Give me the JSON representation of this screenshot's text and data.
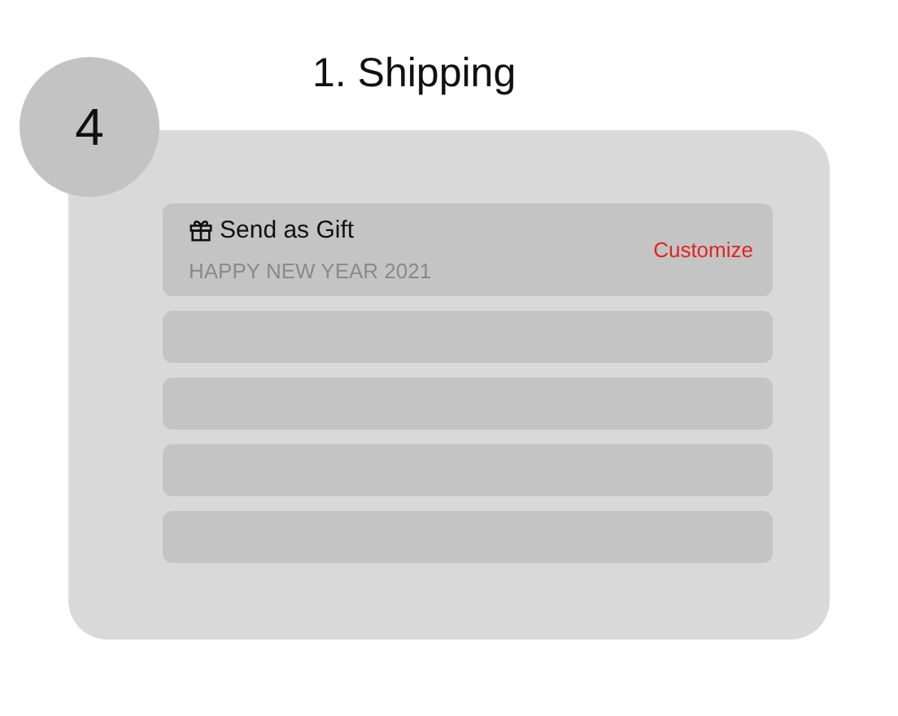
{
  "title": "1. Shipping",
  "step_badge": "4",
  "rows": [
    {
      "kind": "gift",
      "label": "Send as Gift",
      "subtitle": "HAPPY NEW YEAR 2021",
      "action": "Customize"
    },
    {
      "kind": "blank"
    },
    {
      "kind": "blank"
    },
    {
      "kind": "blank"
    },
    {
      "kind": "blank"
    }
  ]
}
